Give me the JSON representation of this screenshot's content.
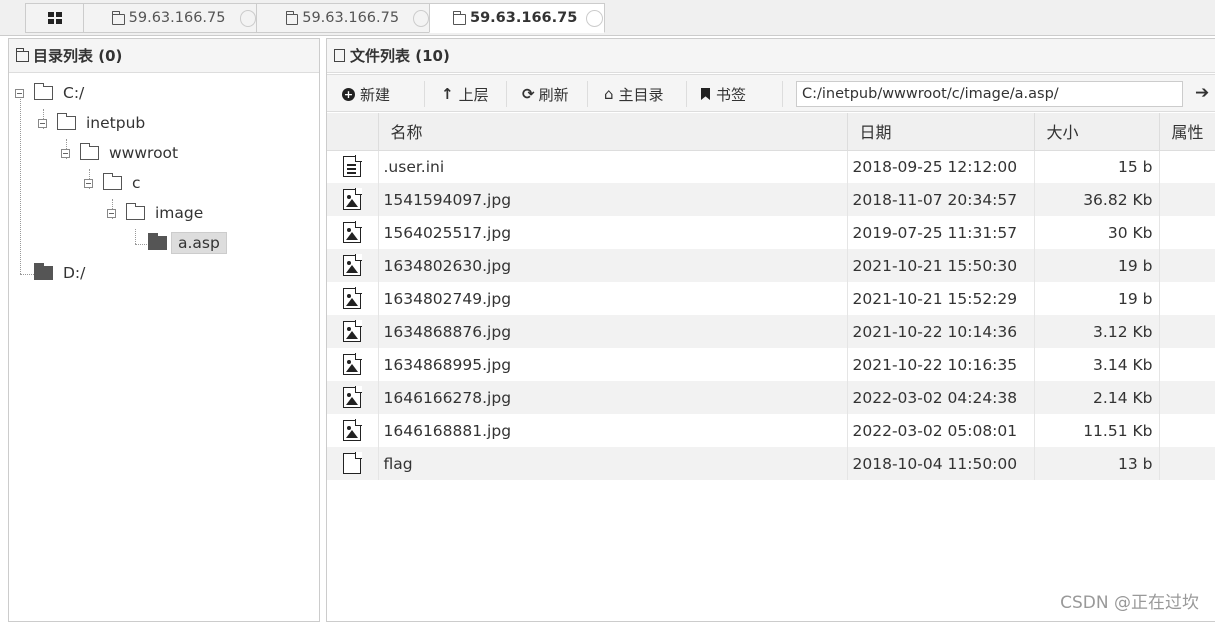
{
  "tabs": [
    {
      "label": "59.63.166.75",
      "active": false
    },
    {
      "label": "59.63.166.75",
      "active": false
    },
    {
      "label": "59.63.166.75",
      "active": true
    }
  ],
  "left_panel": {
    "title": "目录列表 (0)",
    "tree": [
      {
        "label": "C:/"
      },
      {
        "label": "inetpub"
      },
      {
        "label": "wwwroot"
      },
      {
        "label": "c"
      },
      {
        "label": "image"
      },
      {
        "label": "a.asp",
        "selected": true
      },
      {
        "label": "D:/"
      }
    ]
  },
  "right_panel": {
    "title": "文件列表 (10)",
    "toolbar": {
      "new_label": "新建",
      "up_label": "上层",
      "refresh_label": "刷新",
      "home_label": "主目录",
      "bookmark_label": "书签",
      "path_value": "C:/inetpub/wwwroot/c/image/a.asp/"
    },
    "columns": [
      "名称",
      "日期",
      "大小",
      "属性"
    ],
    "files": [
      {
        "icon": "text-file-icon",
        "name": ".user.ini",
        "date": "2018-09-25 12:12:00",
        "size": "15 b"
      },
      {
        "icon": "image-file-icon",
        "name": "1541594097.jpg",
        "date": "2018-11-07 20:34:57",
        "size": "36.82 Kb"
      },
      {
        "icon": "image-file-icon",
        "name": "1564025517.jpg",
        "date": "2019-07-25 11:31:57",
        "size": "30 Kb"
      },
      {
        "icon": "image-file-icon",
        "name": "1634802630.jpg",
        "date": "2021-10-21 15:50:30",
        "size": "19 b"
      },
      {
        "icon": "image-file-icon",
        "name": "1634802749.jpg",
        "date": "2021-10-21 15:52:29",
        "size": "19 b"
      },
      {
        "icon": "image-file-icon",
        "name": "1634868876.jpg",
        "date": "2021-10-22 10:14:36",
        "size": "3.12 Kb"
      },
      {
        "icon": "image-file-icon",
        "name": "1634868995.jpg",
        "date": "2021-10-22 10:16:35",
        "size": "3.14 Kb"
      },
      {
        "icon": "image-file-icon",
        "name": "1646166278.jpg",
        "date": "2022-03-02 04:24:38",
        "size": "2.14 Kb"
      },
      {
        "icon": "image-file-icon",
        "name": "1646168881.jpg",
        "date": "2022-03-02 05:08:01",
        "size": "11.51 Kb"
      },
      {
        "icon": "blank-file-icon",
        "name": "flag",
        "date": "2018-10-04 11:50:00",
        "size": "13 b"
      }
    ]
  },
  "watermark": "CSDN @正在过坎"
}
